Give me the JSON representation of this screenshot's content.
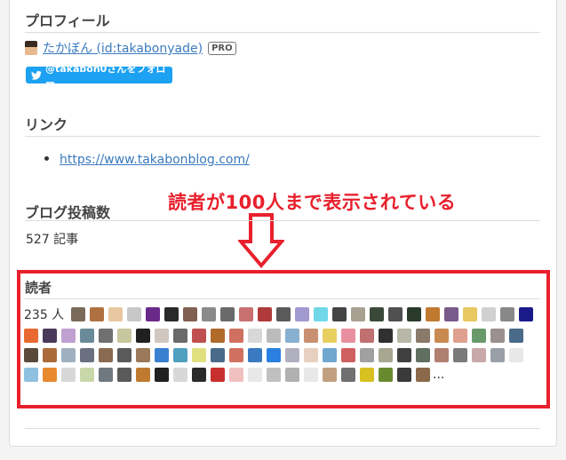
{
  "profile": {
    "title": "プロフィール",
    "name_link": "たかぼん (id:takabonyade)",
    "pro_badge": "PRO",
    "twitter_button": "@takabon0さんをフォロー"
  },
  "links": {
    "title": "リンク",
    "items": [
      "https://www.takabonblog.com/"
    ]
  },
  "posts": {
    "title": "ブログ投稿数",
    "count_text": "527 記事"
  },
  "annotation": {
    "text": "読者が100人まで表示されている",
    "color": "#e8202c"
  },
  "readers": {
    "title": "読者",
    "count_text": "235 人",
    "ellipsis": "...",
    "icon_colors": [
      "#7a6a5a",
      "#b07040",
      "#e8c8a0",
      "#c8c8c8",
      "#6a2a8a",
      "#2a2a2a",
      "#806050",
      "#8a8a8a",
      "#6a6a6a",
      "#c87070",
      "#b03a3a",
      "#5a5a5a",
      "#a09ad0",
      "#70d8e8",
      "#444444",
      "#a8a090",
      "#3a4a3a",
      "#505050",
      "#2a3a2a",
      "#c07a30",
      "#7a5a8a",
      "#e8c860",
      "#d0d0d0",
      "#888888",
      "#1a1a8a",
      "#e86a30",
      "#4a3a5a",
      "#c0a0d0",
      "#6a8a9a",
      "#707070",
      "#c8c8a0",
      "#202020",
      "#d0c8c0",
      "#6a6a6a",
      "#c05050",
      "#b06a2a",
      "#d07060",
      "#d8d8d8",
      "#bcbcbc",
      "#8ab0d0",
      "#c89070",
      "#e8d060",
      "#e890a0",
      "#c07070",
      "#303030",
      "#b8b8a8",
      "#8a7a6a",
      "#c88a50",
      "#e0a090",
      "#6a9a6a",
      "#9a9090",
      "#4a6a8a",
      "#5a4a3a",
      "#aa6a3a",
      "#a0b0c0",
      "#6a7080",
      "#8a6a50",
      "#5a5a5a",
      "#9a7a5a",
      "#3a80d0",
      "#50a0c0",
      "#e0e080",
      "#4a6a8a",
      "#d07060",
      "#3a7ac0",
      "#2a80e0",
      "#b0b0c0",
      "#e8d0c0",
      "#70a8d0",
      "#d06060",
      "#a0a0a0",
      "#a8a890",
      "#404040",
      "#607060",
      "#b08070",
      "#7a7a7a",
      "#c8a8a8",
      "#9aa0a8",
      "#e8e8e8",
      "#90c0e0",
      "#e88a30",
      "#d8d8d8",
      "#c8d8a8",
      "#707880",
      "#5a5a5a",
      "#c07a30",
      "#202020",
      "#d8d8d8",
      "#2a2a2a",
      "#c83030",
      "#f0c0c0",
      "#e8e8e8",
      "#c0c0c0",
      "#b0b0b0",
      "#e8e8e8",
      "#c0a080",
      "#707070",
      "#d8c020",
      "#6a8a30",
      "#3a3a3a",
      "#8a6a4a"
    ]
  }
}
